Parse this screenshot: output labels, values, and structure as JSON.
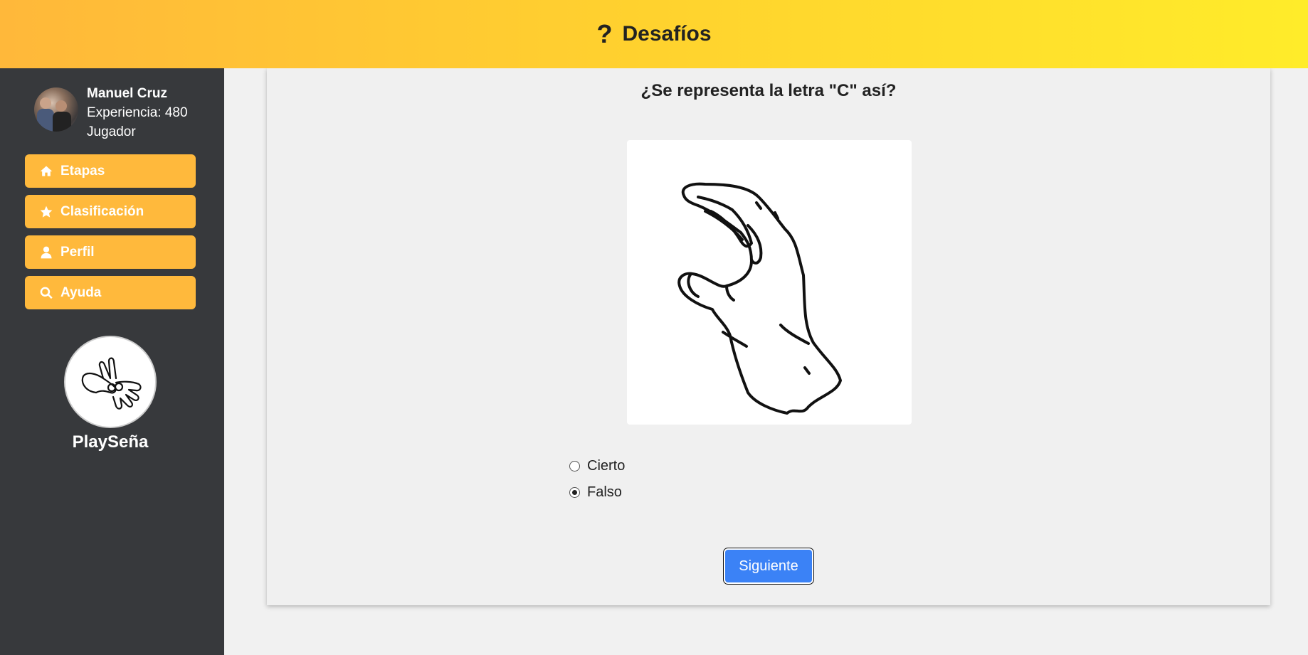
{
  "header": {
    "icon": "question-icon",
    "title": "Desafíos"
  },
  "user": {
    "name": "Manuel Cruz",
    "experience": "Experiencia: 480",
    "role": "Jugador"
  },
  "nav": [
    {
      "label": "Etapas",
      "icon": "home-icon"
    },
    {
      "label": "Clasificación",
      "icon": "star-icon"
    },
    {
      "label": "Perfil",
      "icon": "user-icon"
    },
    {
      "label": "Ayuda",
      "icon": "search-icon"
    }
  ],
  "brand": {
    "name": "PlaySeña"
  },
  "quiz": {
    "question": "¿Se representa la letra \"C\" así?",
    "options": [
      {
        "label": "Cierto",
        "checked": false
      },
      {
        "label": "Falso",
        "checked": true
      }
    ],
    "next_label": "Siguiente"
  },
  "colors": {
    "header_start": "#ffb83a",
    "header_end": "#ffec2a",
    "sidebar": "#37393c",
    "nav_button": "#ffb93c",
    "primary": "#3b82f6"
  }
}
